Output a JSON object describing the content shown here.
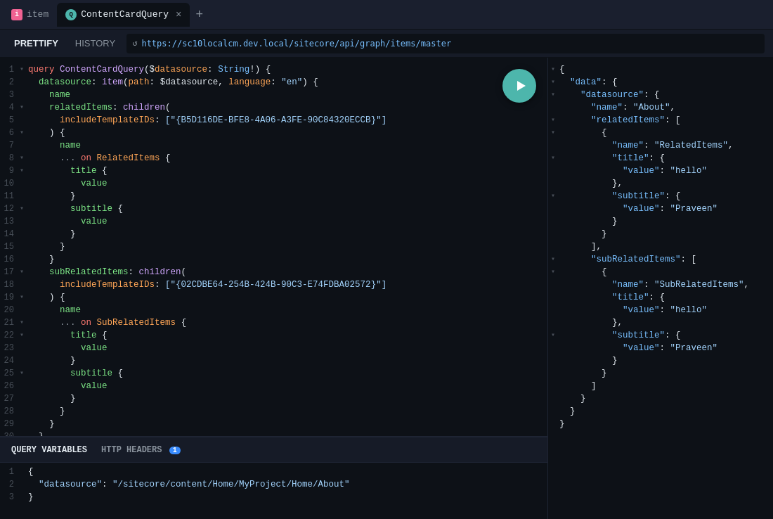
{
  "tabs": [
    {
      "id": "tab-item",
      "label": "item",
      "icon": "pink",
      "active": false,
      "closeable": false
    },
    {
      "id": "tab-query",
      "label": "ContentCardQuery",
      "icon": "blue",
      "active": true,
      "closeable": true
    }
  ],
  "toolbar": {
    "prettify_label": "PRETTIFY",
    "history_label": "HISTORY",
    "url": "https://sc10localcm.dev.local/sitecore/api/graph/items/master"
  },
  "bottom_tabs": [
    {
      "label": "QUERY VARIABLES",
      "active": true,
      "badge": null
    },
    {
      "label": "HTTP HEADERS",
      "active": false,
      "badge": "1"
    }
  ],
  "query_variable_line1": "1   {",
  "query_variable_line2": "2     \"datasource\": \"/sitecore/content/Home/MyProject/Home/About\"",
  "query_variable_line3": "3   }",
  "play_button_label": "▶"
}
